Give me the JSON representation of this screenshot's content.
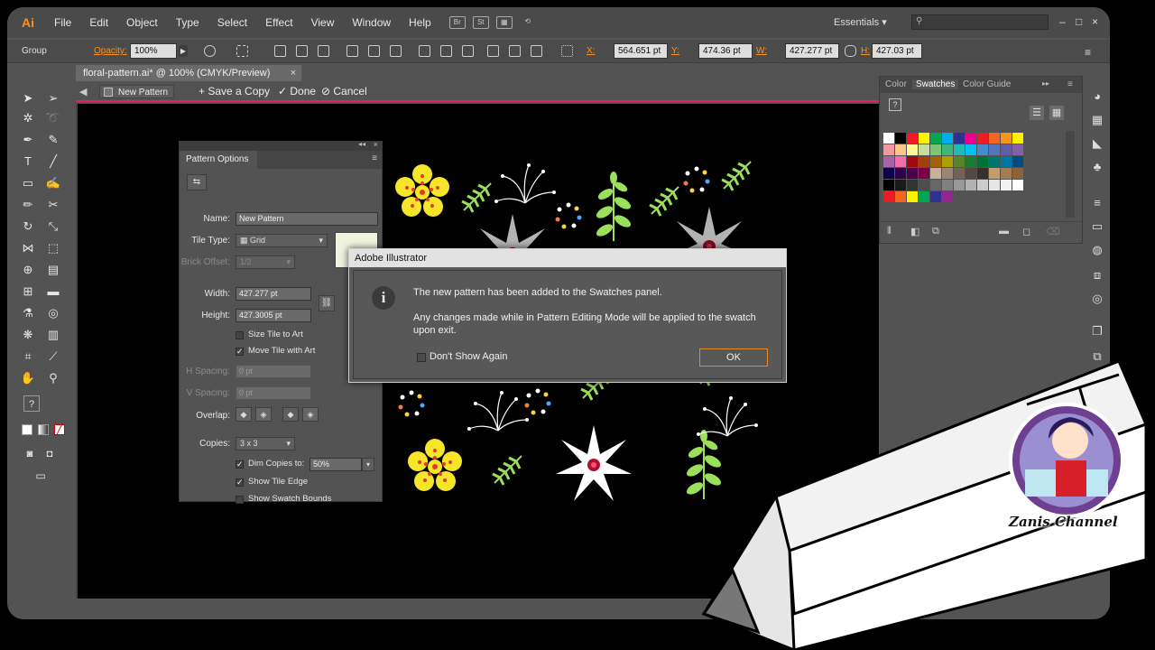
{
  "menubar": {
    "app_logo": "Ai",
    "items": [
      "File",
      "Edit",
      "Object",
      "Type",
      "Select",
      "Effect",
      "View",
      "Window",
      "Help"
    ],
    "mini_icons": [
      "Br",
      "St"
    ],
    "workspace": "Essentials",
    "window_controls": [
      "–",
      "□",
      "×"
    ]
  },
  "control_bar": {
    "selection": "Group",
    "opacity_label": "Opacity:",
    "opacity_value": "100%",
    "x_label": "X:",
    "x_value": "564.651 pt",
    "y_label": "Y:",
    "y_value": "474.36 pt",
    "w_label": "W:",
    "w_value": "427.277 pt",
    "h_label": "H:",
    "h_value": "427.03 pt"
  },
  "doc_tab": {
    "title": "floral-pattern.ai* @ 100% (CMYK/Preview)",
    "close": "×"
  },
  "pattern_bar": {
    "back": "◀",
    "pattern_name": "New Pattern",
    "save_copy": "+ Save a Copy",
    "done": "✓ Done",
    "cancel": "⊘ Cancel"
  },
  "pattern_options": {
    "title": "Pattern Options",
    "name_label": "Name:",
    "name_value": "New Pattern",
    "tile_type_label": "Tile Type:",
    "tile_type_value": "Grid",
    "brick_offset_label": "Brick Offset:",
    "brick_offset_value": "1/2",
    "width_label": "Width:",
    "width_value": "427.277 pt",
    "height_label": "Height:",
    "height_value": "427.3005 pt",
    "size_tile_to_art": "Size Tile to Art",
    "move_tile_with_art": "Move Tile with Art",
    "h_spacing_label": "H Spacing:",
    "h_spacing_value": "0 pt",
    "v_spacing_label": "V Spacing:",
    "v_spacing_value": "0 pt",
    "overlap_label": "Overlap:",
    "copies_label": "Copies:",
    "copies_value": "3 x 3",
    "dim_copies_label": "Dim Copies to:",
    "dim_copies_value": "50%",
    "show_tile_edge": "Show Tile Edge",
    "show_swatch_bounds": "Show Swatch Bounds"
  },
  "swatches_panel": {
    "tabs": [
      "Color",
      "Swatches",
      "Color Guide"
    ],
    "active_tab": "Swatches",
    "colors": {
      "row1": [
        "#ffffff",
        "#000000",
        "#ed1c24",
        "#fff200",
        "#00a651",
        "#00aeef",
        "#2e3192",
        "#ec008c",
        "#ed1c24",
        "#f26522",
        "#f7941d",
        "#fff200"
      ],
      "row2": [
        "#f5989d",
        "#fdc689",
        "#fff799",
        "#c4df9b",
        "#7cc576",
        "#3cb878",
        "#1cbbb4",
        "#00bff3",
        "#448ccb",
        "#5674b9",
        "#605ca8",
        "#8560a8"
      ],
      "row3": [
        "#a864a8",
        "#f06eaa",
        "#9e0b0f",
        "#a0410d",
        "#a36209",
        "#aba000",
        "#598527",
        "#1a7b30",
        "#007236",
        "#00746b",
        "#0076a3",
        "#004b80"
      ],
      "row4": [
        "#0d004c",
        "#32004b",
        "#4b0049",
        "#7b0046",
        "#c7b299",
        "#998675",
        "#736357",
        "#534741",
        "#37302a",
        "#c69c6d",
        "#a67c52",
        "#8c6239"
      ],
      "row5": [
        "#000000",
        "#1a1a1a",
        "#333333",
        "#4d4d4d",
        "#666666",
        "#808080",
        "#999999",
        "#b3b3b3",
        "#cccccc",
        "#e6e6e6",
        "#f2f2f2",
        "#ffffff"
      ],
      "row6": [
        "#ed1c24",
        "#f26522",
        "#fff200",
        "#00a651",
        "#2e3192",
        "#92278f"
      ]
    }
  },
  "dialog": {
    "title": "Adobe Illustrator",
    "message": "The new pattern has been added to the Swatches panel.",
    "detail": "Any changes made while in Pattern Editing Mode will be applied to the swatch upon exit.",
    "dont_show": "Don't Show Again",
    "ok": "OK"
  },
  "brand": {
    "channel_name": "Zanis Channel"
  },
  "colors": {
    "accent_pink": "#e0245e",
    "ok_border": "#e28a2b",
    "flower_yellow": "#f5e62a",
    "leaf_green": "#9be05a"
  }
}
